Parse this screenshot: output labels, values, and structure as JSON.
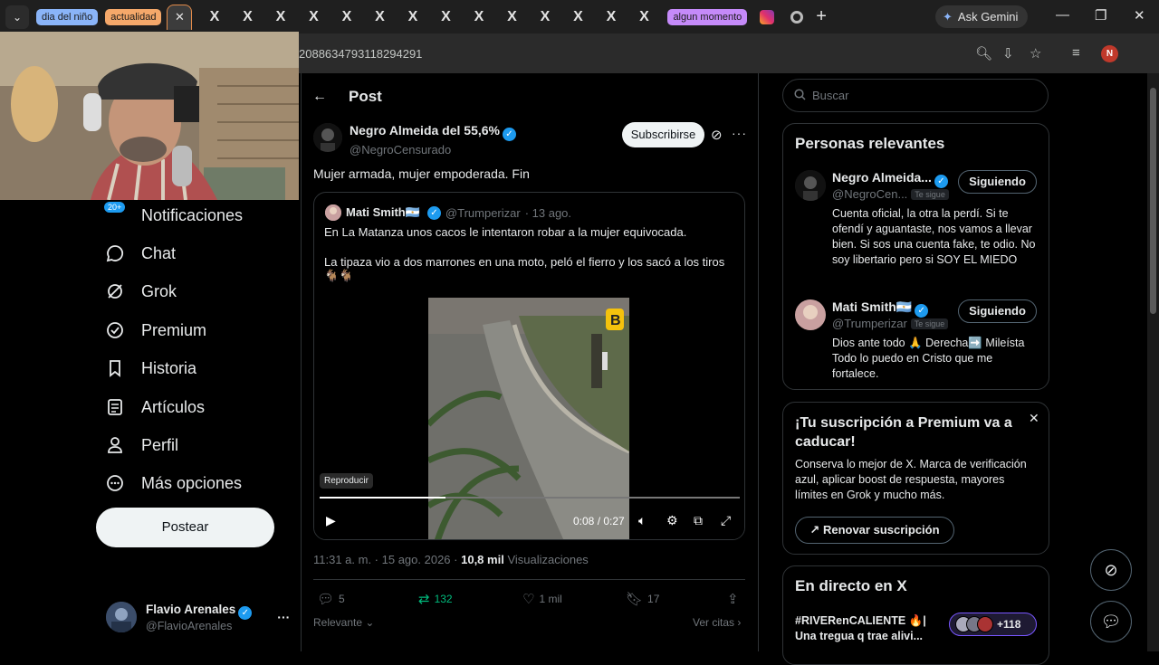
{
  "browser": {
    "tab_groups": [
      {
        "label": "dia del niño",
        "color": "#8ab4f8"
      },
      {
        "label": "actualidad",
        "color": "#f5a86a"
      },
      {
        "label": "algun momento",
        "color": "#c58af9"
      }
    ],
    "x_tab_glyph": "X",
    "ask_gemini": "Ask Gemini",
    "url": "2088634793118294291"
  },
  "nav": {
    "notifications_badge": "20+",
    "items": [
      {
        "label": "Notificaciones",
        "icon": "bell-icon"
      },
      {
        "label": "Chat",
        "icon": "chat-icon"
      },
      {
        "label": "Grok",
        "icon": "grok-icon"
      },
      {
        "label": "Premium",
        "icon": "premium-icon"
      },
      {
        "label": "Historia",
        "icon": "bookmark-icon"
      },
      {
        "label": "Artículos",
        "icon": "article-icon"
      },
      {
        "label": "Perfil",
        "icon": "person-icon"
      },
      {
        "label": "Más opciones",
        "icon": "more-circle-icon"
      }
    ],
    "post_button": "Postear",
    "account": {
      "name": "Flavio Arenales",
      "handle": "@FlavioArenales"
    }
  },
  "post": {
    "header": "Post",
    "author_name": "Negro Almeida del 55,6%",
    "author_handle": "@NegroCensurado",
    "subscribe": "Subscribirse",
    "text": "Mujer armada, mujer empoderada. Fin",
    "quote": {
      "name": "Mati Smith🇦🇷",
      "handle": "@Trumperizar",
      "date": "· 13 ago.",
      "line1": "En La Matanza unos cacos le intentaron robar a la mujer equivocada.",
      "line2": "La tipaza vio a dos marrones en una moto, peló el fierro y los sacó a los tiros",
      "line2_emoji": "�without",
      "video": {
        "play_label": "Reproducir",
        "time": "0:08 / 0:27",
        "progress": 0.3,
        "corner_mark": "B"
      }
    },
    "time": "11:31 a. m. · 15 ago. 2026 ·",
    "views_count": "10,8 mil",
    "views_label": "Visualizaciones",
    "replies": "5",
    "reposts": "132",
    "likes": "1 mil",
    "bookmarks": "17",
    "sort": "Relevante",
    "see_quotes": "Ver citas"
  },
  "sidebar": {
    "search_placeholder": "Buscar",
    "relevant": {
      "title": "Personas relevantes",
      "people": [
        {
          "name": "Negro Almeida...",
          "handle": "@NegroCen...",
          "follows_you": "Te sigue",
          "button": "Siguiendo",
          "bio": "Cuenta oficial, la otra la perdí. Si te ofendí y aguantaste, nos vamos a llevar bien. Si sos una cuenta fake, te odio. No soy libertario pero si SOY EL MIEDO"
        },
        {
          "name": "Mati Smith🇦🇷",
          "handle": "@Trumperizar",
          "follows_you": "Te sigue",
          "button": "Siguiendo",
          "bio": "Dios ante todo 🙏 Derecha➡️ Mileísta Todo lo puedo en Cristo que me fortalece."
        }
      ]
    },
    "premium": {
      "title": "¡Tu suscripción a Premium va a caducar!",
      "body": "Conserva lo mejor de X. Marca de verificación azul, aplicar boost de respuesta, mayores límites en Grok y mucho más.",
      "button": "Renovar suscripción"
    },
    "live": {
      "title": "En directo en X",
      "tag": "#RIVERenCALIENTE 🔥| Una tregua q trae alivi...",
      "count": "+118"
    }
  }
}
